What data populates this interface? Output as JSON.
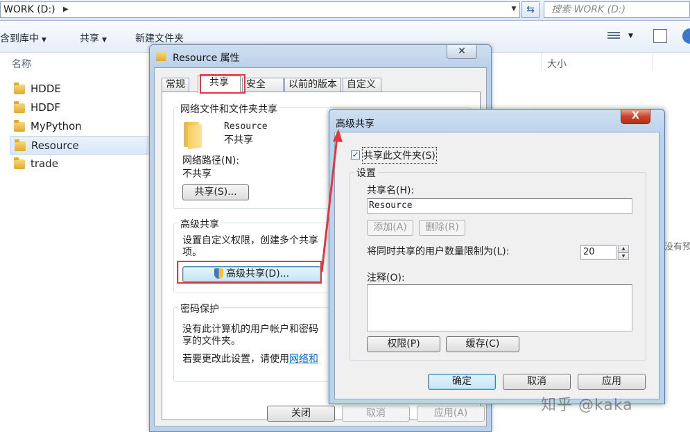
{
  "explorer": {
    "address": "WORK (D:)",
    "search_placeholder": "搜索 WORK (D:)",
    "toolbar": {
      "include_library": "包含到库中",
      "share": "共享",
      "new_folder": "新建文件夹"
    },
    "columns": {
      "name": "名称",
      "size": "大小"
    },
    "files": [
      {
        "name": "HDDE",
        "selected": false
      },
      {
        "name": "HDDF",
        "selected": false
      },
      {
        "name": "MyPython",
        "selected": false
      },
      {
        "name": "Resource",
        "selected": true
      },
      {
        "name": "trade",
        "selected": false
      }
    ],
    "right_hint": "没有预览"
  },
  "props_dialog": {
    "title": "Resource 属性",
    "close_glyph": "✕",
    "tabs": [
      "常规",
      "共享",
      "安全",
      "以前的版本",
      "自定义"
    ],
    "active_tab": "共享",
    "net_share": {
      "title": "网络文件和文件夹共享",
      "folder_name": "Resource",
      "folder_status": "不共享",
      "path_label": "网络路径(N):",
      "path_value": "不共享",
      "share_button": "共享(S)..."
    },
    "advanced": {
      "title": "高级共享",
      "desc_line1": "设置自定义权限，创建多个共享",
      "desc_line2": "项。",
      "button": "高级共享(D)..."
    },
    "password": {
      "title": "密码保护",
      "desc_line1": "没有此计算机的用户帐户和密码",
      "desc_line2": "享的文件夹。",
      "change_prefix": "若要更改此设置，请使用",
      "change_link": "网络和"
    },
    "buttons": {
      "close": "关闭",
      "cancel": "取消",
      "apply": "应用(A)"
    }
  },
  "adv_dialog": {
    "title": "高级共享",
    "close_glyph": "X",
    "share_checkbox": {
      "label": "共享此文件夹(S)",
      "checked": true
    },
    "settings": {
      "title": "设置",
      "share_name_label": "共享名(H):",
      "share_name_value": "Resource",
      "add_button": "添加(A)",
      "remove_button": "删除(R)",
      "limit_label": "将同时共享的用户数量限制为(L):",
      "limit_value": "20",
      "comment_label": "注释(O):",
      "comment_value": "",
      "permissions_button": "权限(P)",
      "caching_button": "缓存(C)"
    },
    "buttons": {
      "ok": "确定",
      "cancel": "取消",
      "apply": "应用"
    }
  },
  "watermark": "知乎 @kaka",
  "colors": {
    "highlight_red": "#e0383e",
    "link_blue": "#0066cc",
    "title_gradient": "#bcd3ec",
    "close_red": "#c7452d"
  }
}
